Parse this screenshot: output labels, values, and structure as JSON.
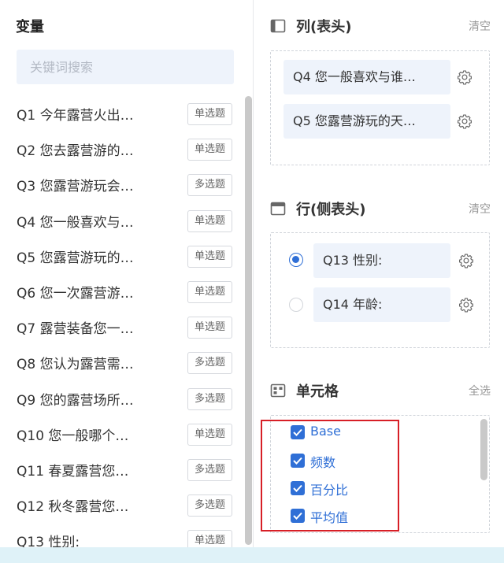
{
  "variables": {
    "title": "变量",
    "search_placeholder": "关键词搜索",
    "items": [
      {
        "name": "Q1 今年露营火出…",
        "type": "单选题"
      },
      {
        "name": "Q2 您去露营游的…",
        "type": "单选题"
      },
      {
        "name": "Q3 您露营游玩会…",
        "type": "多选题"
      },
      {
        "name": "Q4 您一般喜欢与…",
        "type": "单选题"
      },
      {
        "name": "Q5 您露营游玩的…",
        "type": "单选题"
      },
      {
        "name": "Q6 您一次露营游…",
        "type": "单选题"
      },
      {
        "name": "Q7 露营装备您一…",
        "type": "单选题"
      },
      {
        "name": "Q8 您认为露营需…",
        "type": "多选题"
      },
      {
        "name": "Q9 您的露营场所…",
        "type": "多选题"
      },
      {
        "name": "Q10 您一般哪个…",
        "type": "单选题"
      },
      {
        "name": "Q11 春夏露营您…",
        "type": "多选题"
      },
      {
        "name": "Q12 秋冬露营您…",
        "type": "多选题"
      },
      {
        "name": "Q13 性别:",
        "type": "单选题"
      }
    ]
  },
  "columns": {
    "title": "列(表头)",
    "action": "清空",
    "items": [
      "Q4 您一般喜欢与谁…",
      "Q5 您露营游玩的天…"
    ]
  },
  "rows": {
    "title": "行(侧表头)",
    "action": "清空",
    "items": [
      {
        "label": "Q13 性别:",
        "selected": true
      },
      {
        "label": "Q14 年龄:",
        "selected": false
      }
    ]
  },
  "cells": {
    "title": "单元格",
    "action": "全选",
    "options": [
      {
        "label": "Base",
        "checked": true
      },
      {
        "label": "频数",
        "checked": true
      },
      {
        "label": "百分比",
        "checked": true
      },
      {
        "label": "平均值",
        "checked": true
      }
    ]
  },
  "colors": {
    "accent": "#2f6fd6",
    "highlight_border": "#d71f26",
    "chip_bg": "#eef3fb"
  }
}
